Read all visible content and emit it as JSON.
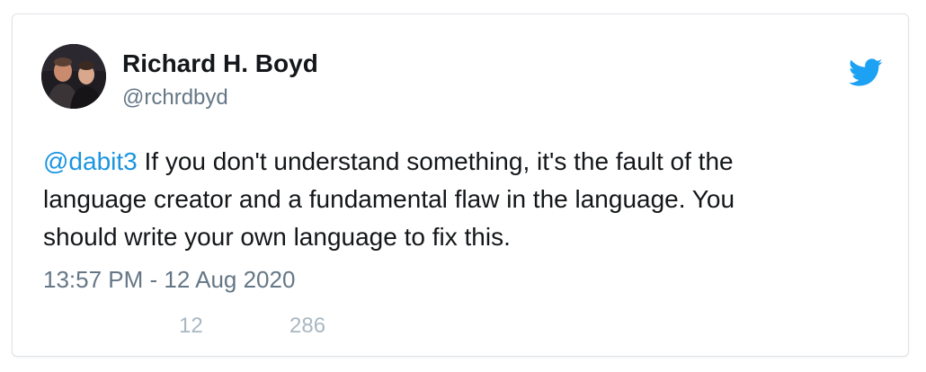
{
  "tweet": {
    "author": {
      "display_name": "Richard H. Boyd",
      "handle": "@rchrdbyd",
      "avatar_icon": "profile-photo"
    },
    "brand_icon": "twitter-bird-icon",
    "brand_color": "#1da1f2",
    "mention_color": "#1b95e0",
    "text": {
      "mention": "@dabit3",
      "line1_rest": " If you don't understand something, it's the fault of the",
      "line2": "language creator and a fundamental flaw in the language. You",
      "line3": "should write your own language to fix this."
    },
    "timestamp": "13:57 PM - 12 Aug 2020",
    "stats": {
      "replies": "12",
      "likes": "286"
    }
  }
}
